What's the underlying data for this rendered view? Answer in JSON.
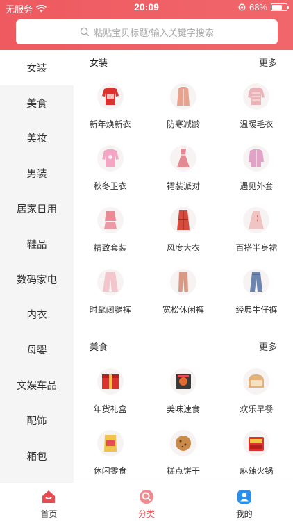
{
  "status_bar": {
    "carrier": "无服务",
    "time": "20:09",
    "battery": "68%",
    "battery_level": 0.68
  },
  "search": {
    "placeholder": "粘贴宝贝标题/输入关键字搜索"
  },
  "sidebar": {
    "items": [
      {
        "label": "女装",
        "active": true
      },
      {
        "label": "美食"
      },
      {
        "label": "美妆"
      },
      {
        "label": "男装"
      },
      {
        "label": "居家日用"
      },
      {
        "label": "鞋品"
      },
      {
        "label": "数码家电"
      },
      {
        "label": "内衣"
      },
      {
        "label": "母婴"
      },
      {
        "label": "文娱车品"
      },
      {
        "label": "配饰"
      },
      {
        "label": "箱包"
      }
    ]
  },
  "sections": [
    {
      "title": "女装",
      "more": "更多",
      "items": [
        {
          "label": "新年焕新衣",
          "icon": "red-sweater-icon",
          "color": "#d9322f"
        },
        {
          "label": "防寒减龄",
          "icon": "pink-coat-icon",
          "color": "#e8a38f"
        },
        {
          "label": "温暖毛衣",
          "icon": "knit-sweater-icon",
          "color": "#e9b3b8"
        },
        {
          "label": "秋冬卫衣",
          "icon": "sweatshirt-icon",
          "color": "#f3a5c4"
        },
        {
          "label": "裙装派对",
          "icon": "dress-icon",
          "color": "#e48a92"
        },
        {
          "label": "遇见外套",
          "icon": "jacket-icon",
          "color": "#e0a3c6"
        },
        {
          "label": "精致套装",
          "icon": "suit-icon",
          "color": "#e98a96"
        },
        {
          "label": "风度大衣",
          "icon": "trench-coat-icon",
          "color": "#d84a3c"
        },
        {
          "label": "百搭半身裙",
          "icon": "skirt-icon",
          "color": "#f1c4c4"
        },
        {
          "label": "时髦阔腿裤",
          "icon": "wide-pants-icon",
          "color": "#f2c6cc"
        },
        {
          "label": "宽松休闲裤",
          "icon": "casual-pants-icon",
          "color": "#d89a84"
        },
        {
          "label": "经典牛仔裤",
          "icon": "jeans-icon",
          "color": "#6c86b0"
        }
      ]
    },
    {
      "title": "美食",
      "more": "更多",
      "items": [
        {
          "label": "年货礼盒",
          "icon": "gift-box-icon",
          "color": "#d9322f"
        },
        {
          "label": "美味速食",
          "icon": "noodle-pack-icon",
          "color": "#3a3a3a"
        },
        {
          "label": "欢乐早餐",
          "icon": "bread-icon",
          "color": "#e2b27a"
        },
        {
          "label": "休闲零食",
          "icon": "snack-bag-icon",
          "color": "#f0c44a"
        },
        {
          "label": "糕点饼干",
          "icon": "cookie-icon",
          "color": "#c98a4a"
        },
        {
          "label": "麻辣火锅",
          "icon": "hotpot-icon",
          "color": "#d9322f"
        }
      ]
    }
  ],
  "tabbar": {
    "items": [
      {
        "label": "首页"
      },
      {
        "label": "分类",
        "active": true
      },
      {
        "label": "我的"
      }
    ]
  },
  "colors": {
    "header": "#ee5a60",
    "accent": "#e94b52",
    "sidebar_bg": "#f5f5f5"
  }
}
